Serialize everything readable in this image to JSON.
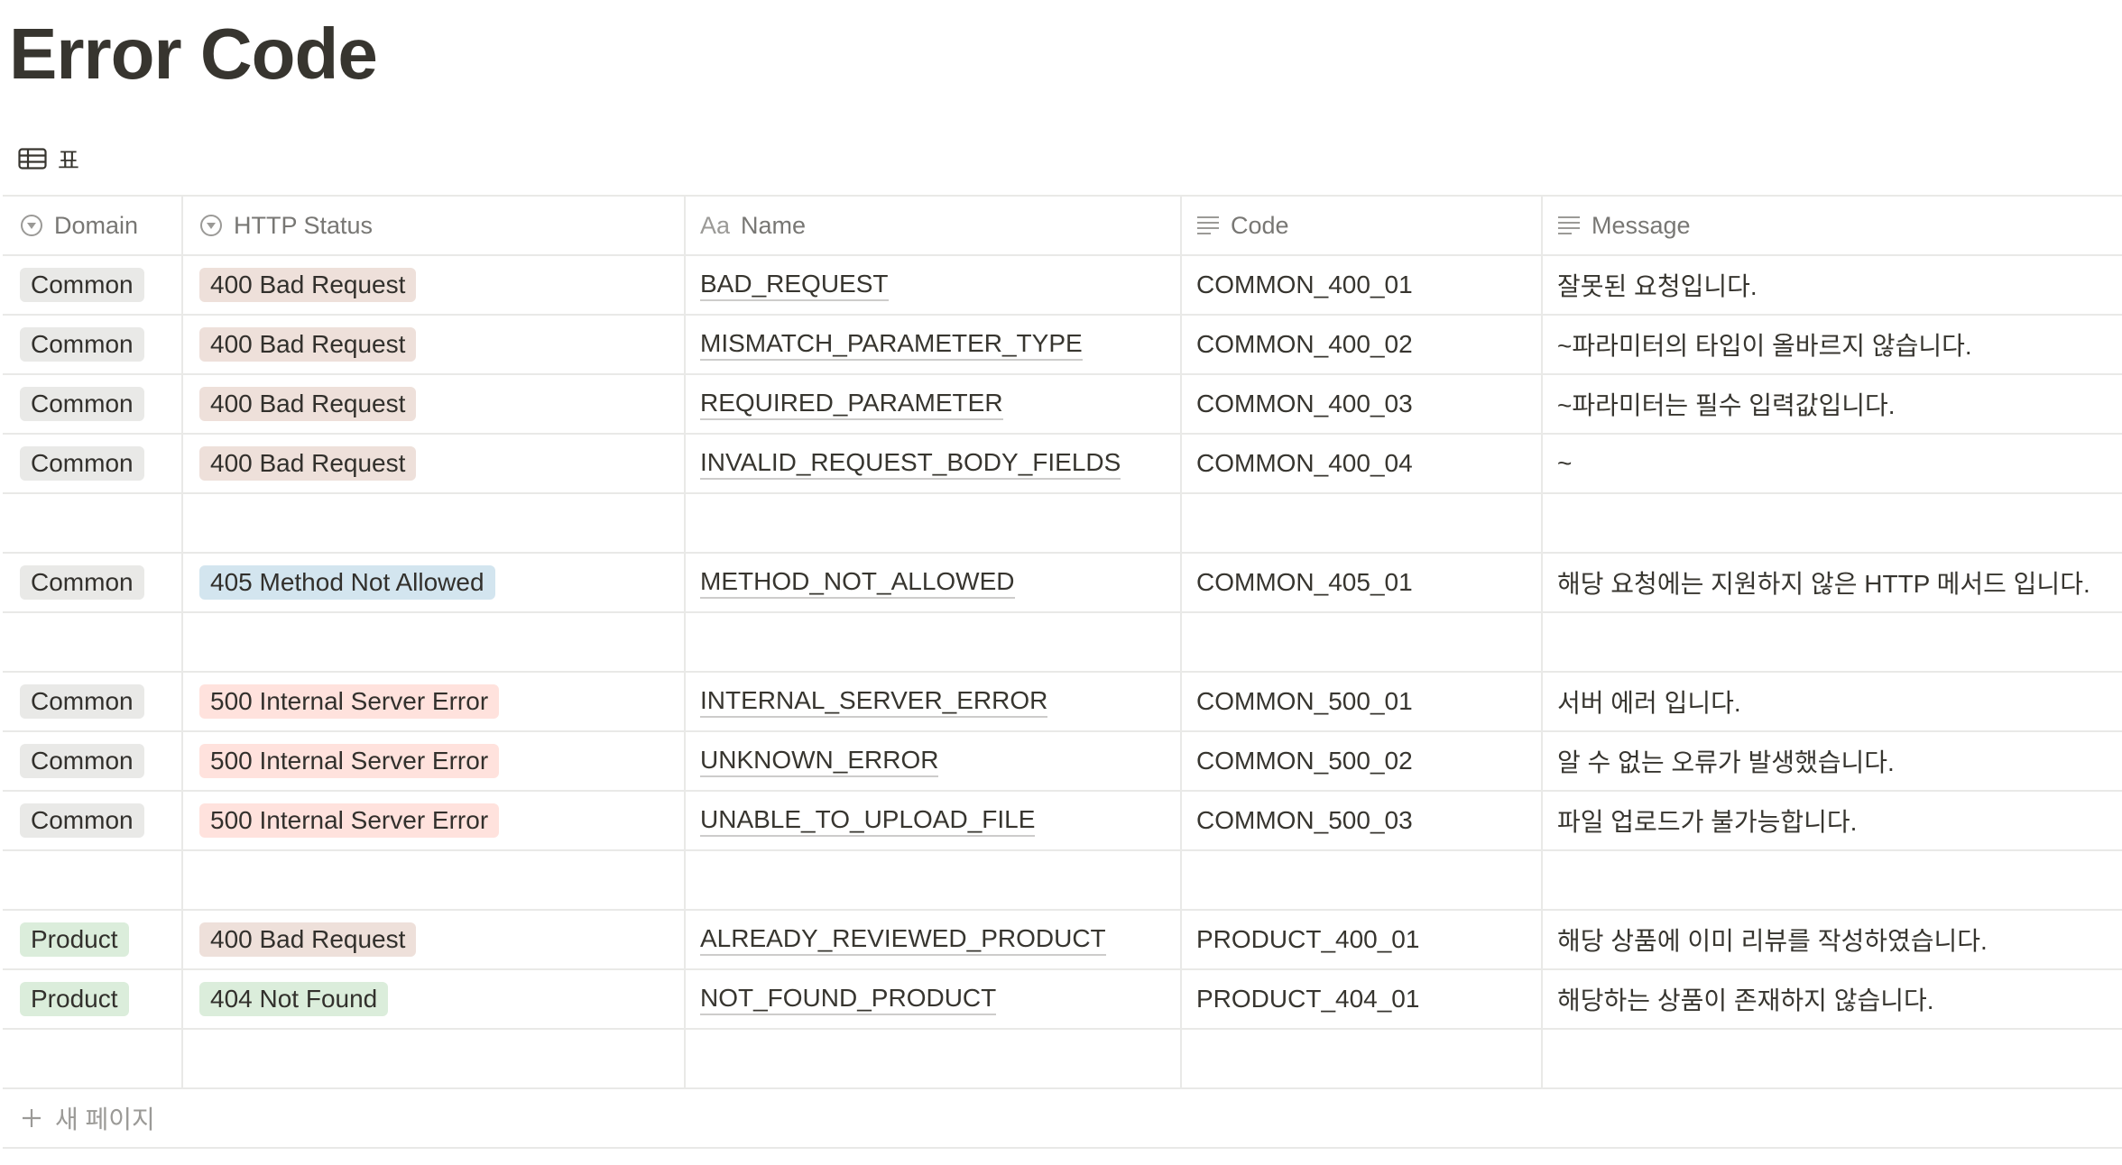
{
  "page": {
    "title": "Error Code"
  },
  "view": {
    "label": "표",
    "icon": "table-icon"
  },
  "columns": [
    {
      "label": "Domain",
      "icon": "select-icon"
    },
    {
      "label": "HTTP Status",
      "icon": "select-icon"
    },
    {
      "label": "Name",
      "icon": "title-icon",
      "icon_text": "Aa"
    },
    {
      "label": "Code",
      "icon": "text-icon"
    },
    {
      "label": "Message",
      "icon": "text-icon"
    }
  ],
  "tag_colors": {
    "gray": "#e9e9e7",
    "brown": "#eee0da",
    "blue": "#d3e5ef",
    "red": "#ffe2dd",
    "green": "#dbeddb"
  },
  "rows": [
    {
      "domain": "Common",
      "domain_color": "gray",
      "status": "400 Bad Request",
      "status_color": "brown",
      "name": "BAD_REQUEST",
      "code": "COMMON_400_01",
      "message": "잘못된 요청입니다."
    },
    {
      "domain": "Common",
      "domain_color": "gray",
      "status": "400 Bad Request",
      "status_color": "brown",
      "name": "MISMATCH_PARAMETER_TYPE",
      "code": "COMMON_400_02",
      "message": "~파라미터의 타입이 올바르지 않습니다."
    },
    {
      "domain": "Common",
      "domain_color": "gray",
      "status": "400 Bad Request",
      "status_color": "brown",
      "name": "REQUIRED_PARAMETER",
      "code": "COMMON_400_03",
      "message": "~파라미터는 필수 입력값입니다."
    },
    {
      "domain": "Common",
      "domain_color": "gray",
      "status": "400 Bad Request",
      "status_color": "brown",
      "name": "INVALID_REQUEST_BODY_FIELDS",
      "code": "COMMON_400_04",
      "message": "~"
    },
    {
      "empty": true
    },
    {
      "domain": "Common",
      "domain_color": "gray",
      "status": "405 Method Not Allowed",
      "status_color": "blue",
      "name": "METHOD_NOT_ALLOWED",
      "code": "COMMON_405_01",
      "message": "해당 요청에는 지원하지 않은 HTTP 메서드 입니다."
    },
    {
      "empty": true
    },
    {
      "domain": "Common",
      "domain_color": "gray",
      "status": "500 Internal Server Error",
      "status_color": "red",
      "name": "INTERNAL_SERVER_ERROR",
      "code": "COMMON_500_01",
      "message": "서버 에러 입니다."
    },
    {
      "domain": "Common",
      "domain_color": "gray",
      "status": "500 Internal Server Error",
      "status_color": "red",
      "name": "UNKNOWN_ERROR",
      "code": "COMMON_500_02",
      "message": "알 수 없는 오류가 발생했습니다."
    },
    {
      "domain": "Common",
      "domain_color": "gray",
      "status": "500 Internal Server Error",
      "status_color": "red",
      "name": "UNABLE_TO_UPLOAD_FILE",
      "code": "COMMON_500_03",
      "message": "파일 업로드가 불가능합니다."
    },
    {
      "empty": true
    },
    {
      "domain": "Product",
      "domain_color": "green",
      "status": "400 Bad Request",
      "status_color": "brown",
      "name": "ALREADY_REVIEWED_PRODUCT",
      "code": "PRODUCT_400_01",
      "message": "해당 상품에 이미 리뷰를 작성하였습니다."
    },
    {
      "domain": "Product",
      "domain_color": "green",
      "status": "404 Not Found",
      "status_color": "green",
      "name": "NOT_FOUND_PRODUCT",
      "code": "PRODUCT_404_01",
      "message": "해당하는 상품이 존재하지 않습니다."
    },
    {
      "empty": true
    }
  ],
  "footer": {
    "new_page_label": "새 페이지",
    "icon": "plus-icon"
  }
}
